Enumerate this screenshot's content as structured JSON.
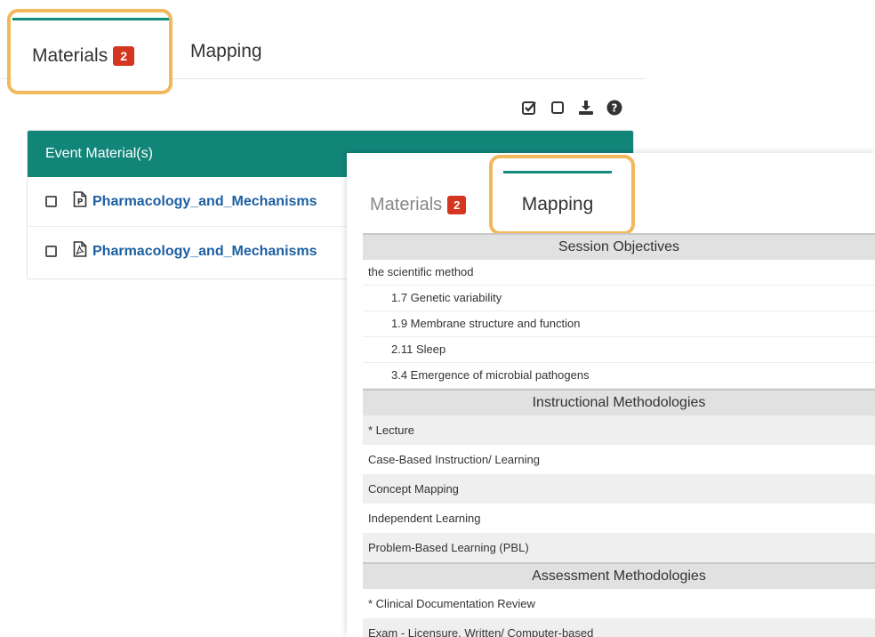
{
  "tabs_primary": {
    "materials_label": "Materials",
    "materials_count": "2",
    "mapping_label": "Mapping"
  },
  "toolbar": {
    "icons": [
      "check-all-icon",
      "uncheck-all-icon",
      "download-icon",
      "help-icon"
    ]
  },
  "materials_panel": {
    "header": "Event Material(s)",
    "items": [
      {
        "name": "Pharmacology_and_Mechanisms",
        "icon": "powerpoint-file-icon"
      },
      {
        "name": "Pharmacology_and_Mechanisms",
        "icon": "pdf-file-icon"
      }
    ]
  },
  "tabs_secondary": {
    "materials_label": "Materials",
    "materials_count": "2",
    "mapping_label": "Mapping"
  },
  "mapping": {
    "session_objectives": {
      "header": "Session Objectives",
      "top": "the scientific method",
      "items": [
        "1.7 Genetic variability",
        "1.9 Membrane structure and function",
        "2.11 Sleep",
        "3.4 Emergence of microbial pathogens"
      ]
    },
    "instructional_methodologies": {
      "header": "Instructional Methodologies",
      "items": [
        "* Lecture",
        "Case-Based Instruction/ Learning",
        "Concept Mapping",
        "Independent Learning",
        "Problem-Based Learning (PBL)"
      ]
    },
    "assessment_methodologies": {
      "header": "Assessment Methodologies",
      "items": [
        "* Clinical Documentation Review",
        "Exam - Licensure, Written/ Computer-based"
      ]
    }
  },
  "colors": {
    "accent_teal": "#128579",
    "badge_red": "#d4361f",
    "highlight_orange": "#f1b95c",
    "link_blue": "#1c5fa1"
  }
}
